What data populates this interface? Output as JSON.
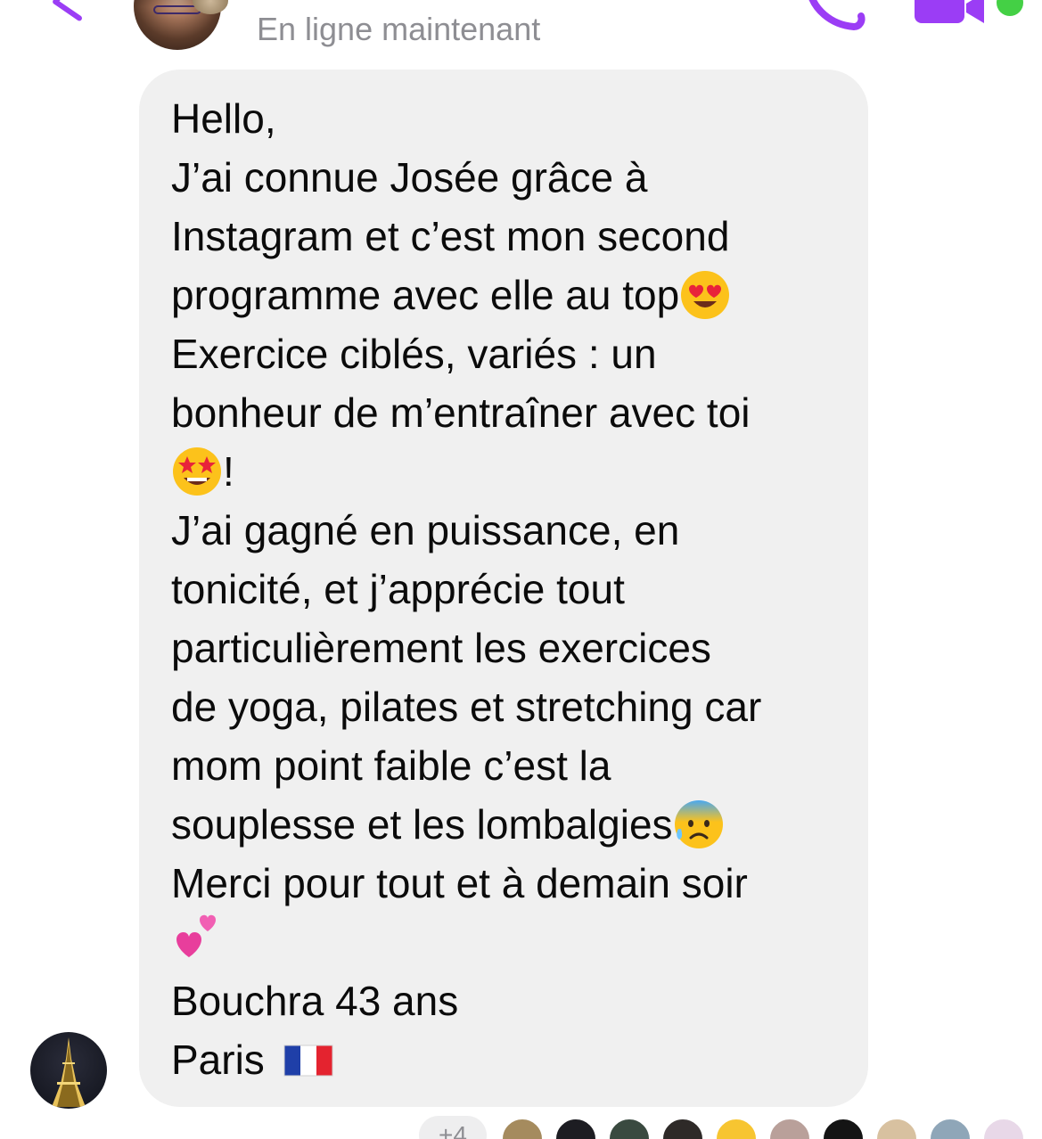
{
  "header": {
    "status": "En ligne maintenant",
    "accent_color": "#9b3df5",
    "icons": [
      "chevron-left-icon",
      "phone-icon",
      "video-camera-icon"
    ]
  },
  "message": {
    "lines": [
      "Hello,",
      "J’ai connue Josée grâce à",
      "Instagram et c’est mon second",
      "programme avec elle au top",
      "Exercice ciblés, variés : un",
      "bonheur de m’entraîner avec toi",
      "!",
      "J’ai gagné en puissance, en",
      "tonicité, et j’apprécie tout",
      "particulièrement les exercices",
      "de yoga, pilates et stretching car",
      "mom point faible c’est la",
      "souplesse et les lombalgies",
      "Merci pour tout et à demain soir",
      "",
      "Bouchra 43 ans",
      "Paris"
    ],
    "emojis": {
      "line_4": "heart-eyes-emoji",
      "line_7": "star-struck-emoji",
      "line_13": "anxious-sweat-emoji",
      "line_15": "two-hearts-emoji",
      "line_17": "france-flag-emoji"
    },
    "bubble_color": "#f0f0f0"
  },
  "receipts": {
    "more_label": "+4"
  }
}
